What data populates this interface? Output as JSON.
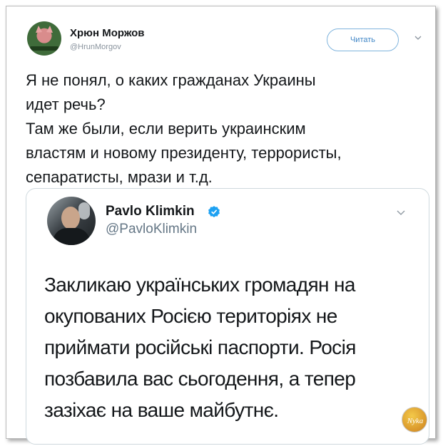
{
  "tweet": {
    "author_name": "Хрюн Моржов",
    "author_handle": "@HrunMorgov",
    "follow_label": "Читать",
    "text_lines": [
      "Я не понял, о каких гражданах Украины",
      "идет речь?",
      "Там же были, если верить украинским",
      "властям и новому президенту, террористы,",
      "сепаратисты, мрази и т.д."
    ]
  },
  "quoted": {
    "author_name": "Pavlo Klimkin",
    "author_handle": "@PavloKlimkin",
    "text_lines": [
      "Закликаю українських громадян на",
      "окупованих Росією територіях не",
      "приймати російські паспорти. Росія",
      "позбавила вас сьогодення, а тепер",
      "зазіхає на ваше майбутнє."
    ]
  },
  "watermark": {
    "text": "Nyka"
  },
  "colors": {
    "link_blue": "#3f86c6",
    "verified_blue": "#1da1f2",
    "text": "#14171a",
    "muted": "#657786"
  },
  "icons": {
    "verified": "verified-badge-icon",
    "chevron": "chevron-down-icon"
  }
}
